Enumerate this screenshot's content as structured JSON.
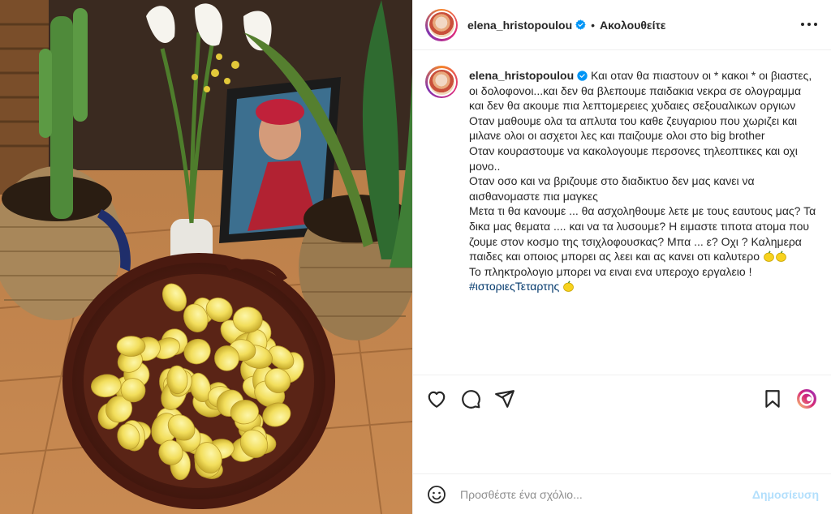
{
  "post": {
    "image_alt": "Basket of lemons on a wooden floor with plants and a framed portrait",
    "author": "elena_hristopoulou",
    "follow_state": "Ακολουθείτε",
    "separator": "•"
  },
  "caption": {
    "lines": [
      "Και οταν θα πιαστουν οι * κακοι * οι βιαστες, οι δολοφονοι...και δεν θα βλεπουμε παιδακια νεκρα σε ολογραμμα και δεν θα ακουμε πια λεπτομερειες χυδαιες σεξουαλικων οργιων",
      "Οταν μαθουμε ολα τα απλυτα του καθε ζευγαριου που χωριζει και μιλανε ολοι οι ασχετοι λες και παιζουμε ολοι στο big brother",
      "Οταν κουραστουμε να κακολογουμε περσονες τηλεοπτικες και οχι μονο..",
      "Οταν οσο και να βριζουμε στο διαδικτυο δεν μας κανει να αισθανομαστε πια μαγκες",
      "Μετα τι θα κανουμε ... θα ασχοληθουμε λετε με τους εαυτους μας? Τα δικα μας θεματα .... και να τα λυσουμε? Η ειμαστε τιποτα ατομα που ζουμε στον κοσμο της τσιχλοφουσκας? Μπα ... ε? Οχι ? Καλημερα παιδες και οποιος μπορει ας λεει και ας κανει οτι καλυτερο",
      "Το πληκτρολογιο μπορει να ειναι ενα υπεροχο εργαλειο !"
    ],
    "hashtag": "#ιστοριεςΤεταρτης"
  },
  "comment": {
    "placeholder": "Προσθέστε ένα σχόλιο...",
    "post_label": "Δημοσίευση"
  },
  "icons": {
    "more": "more-options-icon",
    "like": "heart-icon",
    "comment": "comment-icon",
    "share": "share-icon",
    "save": "bookmark-icon",
    "emoji": "emoji-icon",
    "lemon": "lemon-emoji",
    "verified": "verified-badge-icon"
  },
  "colors": {
    "text": "#262626",
    "hashtag": "#00376b",
    "post_disabled": "#b2dffc",
    "verified": "#0095f6",
    "divider": "#efefef"
  }
}
